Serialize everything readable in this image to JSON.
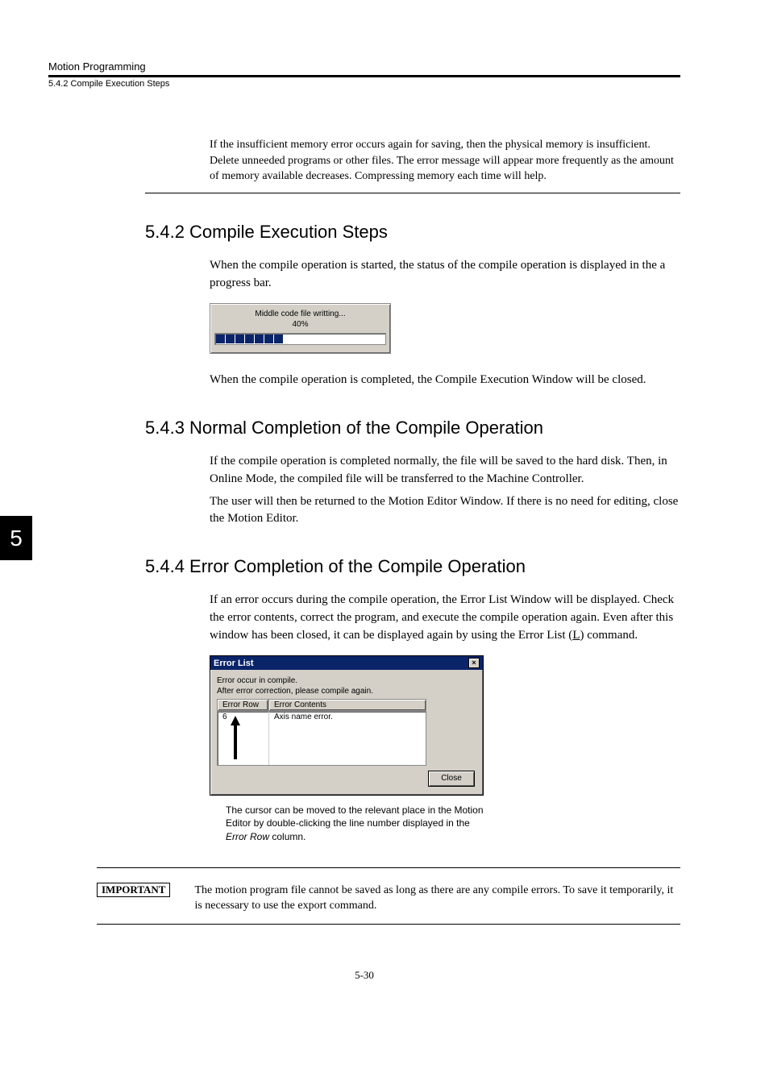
{
  "header": {
    "title": "Motion Programming",
    "subtitle": "5.4.2  Compile Execution Steps"
  },
  "intro_note": "If the insufficient memory error occurs again for saving, then the physical memory is insufficient. Delete unneeded programs or other files. The error message will appear more frequently as the amount of memory available decreases. Compressing memory each time will help.",
  "chapter_tab": "5",
  "section_542": {
    "heading": "5.4.2  Compile Execution Steps",
    "para1": "When the compile operation is started, the status of the compile operation is displayed in the a progress bar.",
    "progress": {
      "line1": "Middle code file writting...",
      "line2": "40%"
    },
    "para2": "When the compile operation is completed, the Compile Execution Window will be closed."
  },
  "section_543": {
    "heading": "5.4.3  Normal Completion of the Compile Operation",
    "para1": "If the compile operation is completed normally, the file will be saved to the hard disk. Then, in Online Mode, the compiled file will be transferred to the Machine Controller.",
    "para2": "The user will then be returned to the Motion Editor Window. If there is no need for editing, close the Motion Editor."
  },
  "section_544": {
    "heading": "5.4.4  Error Completion of the Compile Operation",
    "para1_a": "If an error occurs during the compile operation, the Error List Window will be displayed. Check the error contents, correct the program, and execute the compile operation again. Even after this window has been closed, it can be displayed again by using the Error List (",
    "para1_link": "L",
    "para1_b": ") command.",
    "dialog": {
      "title": "Error List",
      "close_x": "×",
      "msg1": "Error occur in compile.",
      "msg2": "After error correction, please compile again.",
      "col1": "Error Row",
      "col2": "Error Contents",
      "row_num": "6",
      "row_err": "Axis name error.",
      "close_btn": "Close"
    },
    "caption_a": "The cursor can be moved to the relevant place in the Motion Editor by double-clicking the line number displayed in the ",
    "caption_italic": "Error Row",
    "caption_b": " column."
  },
  "important": {
    "label": "IMPORTANT",
    "text": "The motion program file cannot be saved as long as there are any compile errors. To save it temporarily, it is necessary to use the export command."
  },
  "page_number": "5-30"
}
